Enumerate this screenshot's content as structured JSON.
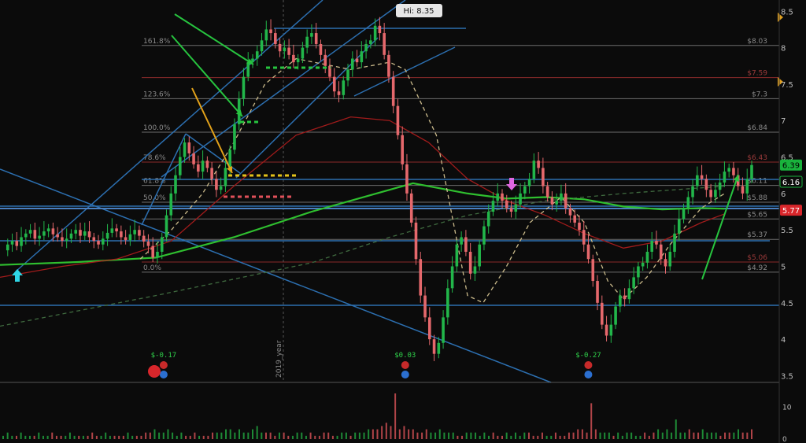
{
  "chart_data": {
    "type": "candlestick",
    "hi_label": "Hi: 8.35",
    "y_axis": {
      "range": [
        3.3,
        8.6
      ],
      "ticks": [
        "3.5",
        "4",
        "4.5",
        "5",
        "5.5",
        "6",
        "6.5",
        "7",
        "7.5",
        "8",
        "8.5"
      ]
    },
    "volume_axis": {
      "ticks": [
        "10",
        "0"
      ]
    },
    "x_annotations": {
      "divider_label": "2019_year"
    },
    "fib_levels": [
      {
        "pct": "161.8%",
        "price": "$8.03",
        "value": 8.03,
        "color": "#6d6d6d"
      },
      {
        "pct": "",
        "price": "$7.59",
        "value": 7.59,
        "color": "#8b2a2a"
      },
      {
        "pct": "123.6%",
        "price": "$7.3",
        "value": 7.3,
        "color": "#6d6d6d"
      },
      {
        "pct": "100.0%",
        "price": "$6.84",
        "value": 6.84,
        "color": "#6d6d6d"
      },
      {
        "pct": "78.6%",
        "price": "$6.43",
        "value": 6.43,
        "color": "#8b2a2a"
      },
      {
        "pct": "61.8%",
        "price": "$6.11",
        "value": 6.11,
        "color": "#6d6d6d"
      },
      {
        "pct": "50.0%",
        "price": "$5.88",
        "value": 5.88,
        "color": "#6d6d6d"
      },
      {
        "pct": "",
        "price": "$5.65",
        "value": 5.65,
        "color": "#6d6d6d"
      },
      {
        "pct": "",
        "price": "$5.37",
        "value": 5.37,
        "color": "#6d6d6d"
      },
      {
        "pct": "",
        "price": "$5.06",
        "value": 5.06,
        "color": "#8b2a2a"
      },
      {
        "pct": "0.0%",
        "price": "$4.92",
        "value": 4.92,
        "color": "#6d6d6d"
      }
    ],
    "price_badges": [
      {
        "label": "6.39",
        "value": 6.39,
        "bg": "#19b23c",
        "fg": "#000000"
      },
      {
        "label": "6.16",
        "value": 6.16,
        "bg": "#0b0b0b",
        "fg": "#ffffff",
        "border": "#19b23c"
      },
      {
        "label": "5.77",
        "value": 5.77,
        "bg": "#d8262b",
        "fg": "#ffffff"
      }
    ],
    "earnings": [
      {
        "label": "$-0.17",
        "x_frac": 0.21
      },
      {
        "label": "$0.03",
        "x_frac": 0.52
      },
      {
        "label": "$-0.27",
        "x_frac": 0.755
      }
    ],
    "series": [
      {
        "name": "Price",
        "color_up": "#22b64a",
        "color_down": "#e5686c",
        "path": [
          5.22,
          5.3,
          5.35,
          5.28,
          5.4,
          5.45,
          5.5,
          5.38,
          5.42,
          5.48,
          5.52,
          5.44,
          5.4,
          5.35,
          5.38,
          5.45,
          5.5,
          5.42,
          5.48,
          5.4,
          5.35,
          5.3,
          5.38,
          5.46,
          5.52,
          5.48,
          5.4,
          5.36,
          5.44,
          5.5,
          5.42,
          5.34,
          5.28,
          5.12,
          5.2,
          5.4,
          5.7,
          6.0,
          6.25,
          6.5,
          6.7,
          6.55,
          6.4,
          6.3,
          6.45,
          6.35,
          6.2,
          6.05,
          6.1,
          6.35,
          6.6,
          6.95,
          7.3,
          7.6,
          7.8,
          7.85,
          7.95,
          8.1,
          8.25,
          8.2,
          8.05,
          7.95,
          8.0,
          7.9,
          7.8,
          7.85,
          8.0,
          8.15,
          8.2,
          8.05,
          7.9,
          7.75,
          7.6,
          7.4,
          7.35,
          7.55,
          7.7,
          7.85,
          7.8,
          7.95,
          8.05,
          8.1,
          8.3,
          8.2,
          7.9,
          7.6,
          7.2,
          6.8,
          6.4,
          6.0,
          5.6,
          5.1,
          4.6,
          4.3,
          4.0,
          3.8,
          3.95,
          4.3,
          4.7,
          5.0,
          5.3,
          5.4,
          5.2,
          4.9,
          5.0,
          5.3,
          5.55,
          5.75,
          5.9,
          6.0,
          5.9,
          5.8,
          5.75,
          5.85,
          6.0,
          6.1,
          6.2,
          6.45,
          6.35,
          6.1,
          5.95,
          5.85,
          5.9,
          6.0,
          5.8,
          5.7,
          5.6,
          5.5,
          5.3,
          5.1,
          4.8,
          4.5,
          4.2,
          4.05,
          4.2,
          4.45,
          4.6,
          4.55,
          4.7,
          4.85,
          5.0,
          5.05,
          5.2,
          5.35,
          5.3,
          5.1,
          5.0,
          5.2,
          5.45,
          5.65,
          5.8,
          5.95,
          6.1,
          6.25,
          6.2,
          6.05,
          5.95,
          6.05,
          6.15,
          6.3,
          6.35,
          6.25,
          6.1,
          6.0,
          6.2,
          6.39
        ]
      }
    ],
    "moving_averages": [
      {
        "name": "",
        "color": "#2fbf2f",
        "style": "solid",
        "points": [
          [
            0,
            5.02
          ],
          [
            0.1,
            5.06
          ],
          [
            0.2,
            5.12
          ],
          [
            0.3,
            5.4
          ],
          [
            0.4,
            5.75
          ],
          [
            0.5,
            6.05
          ],
          [
            0.53,
            6.14
          ],
          [
            0.6,
            6.0
          ],
          [
            0.65,
            5.93
          ],
          [
            0.7,
            5.95
          ],
          [
            0.75,
            5.92
          ],
          [
            0.8,
            5.82
          ],
          [
            0.85,
            5.78
          ],
          [
            0.9,
            5.8
          ],
          [
            0.93,
            5.79
          ]
        ]
      },
      {
        "name": "",
        "color": "#a11b1b",
        "style": "solid",
        "points": [
          [
            0,
            4.85
          ],
          [
            0.08,
            5.0
          ],
          [
            0.15,
            5.1
          ],
          [
            0.22,
            5.35
          ],
          [
            0.3,
            6.1
          ],
          [
            0.38,
            6.8
          ],
          [
            0.45,
            7.05
          ],
          [
            0.5,
            7.0
          ],
          [
            0.55,
            6.7
          ],
          [
            0.6,
            6.2
          ],
          [
            0.65,
            5.9
          ],
          [
            0.7,
            5.7
          ],
          [
            0.75,
            5.45
          ],
          [
            0.8,
            5.25
          ],
          [
            0.85,
            5.35
          ],
          [
            0.9,
            5.6
          ],
          [
            0.93,
            5.72
          ]
        ]
      },
      {
        "name": "",
        "color": "#c9b98a",
        "style": "dashed",
        "points": [
          [
            0.18,
            5.1
          ],
          [
            0.22,
            5.5
          ],
          [
            0.26,
            6.0
          ],
          [
            0.3,
            6.7
          ],
          [
            0.34,
            7.5
          ],
          [
            0.38,
            7.85
          ],
          [
            0.45,
            7.7
          ],
          [
            0.5,
            7.8
          ],
          [
            0.52,
            7.7
          ],
          [
            0.56,
            6.8
          ],
          [
            0.58,
            5.7
          ],
          [
            0.6,
            4.6
          ],
          [
            0.62,
            4.5
          ],
          [
            0.65,
            5.0
          ],
          [
            0.68,
            5.6
          ],
          [
            0.72,
            5.95
          ],
          [
            0.75,
            5.6
          ],
          [
            0.78,
            4.8
          ],
          [
            0.8,
            4.55
          ],
          [
            0.83,
            4.85
          ],
          [
            0.86,
            5.3
          ],
          [
            0.9,
            5.8
          ],
          [
            0.93,
            6.0
          ]
        ]
      },
      {
        "name": "",
        "color": "#3f6a3f",
        "style": "dashed",
        "points": [
          [
            0,
            4.18
          ],
          [
            0.2,
            4.6
          ],
          [
            0.4,
            5.05
          ],
          [
            0.5,
            5.4
          ],
          [
            0.6,
            5.7
          ],
          [
            0.7,
            5.9
          ],
          [
            0.8,
            6.0
          ],
          [
            0.93,
            6.1
          ]
        ]
      }
    ],
    "volume": [
      1,
      2,
      1,
      1,
      2,
      1,
      1,
      1,
      2,
      1,
      1,
      2,
      1,
      1,
      1,
      2,
      1,
      1,
      1,
      1,
      2,
      1,
      1,
      2,
      1,
      1,
      1,
      1,
      2,
      1,
      1,
      1,
      2,
      2,
      3,
      2,
      2,
      3,
      2,
      1,
      2,
      1,
      1,
      2,
      1,
      1,
      1,
      2,
      2,
      2,
      3,
      3,
      2,
      3,
      2,
      2,
      3,
      4,
      2,
      2,
      2,
      1,
      2,
      2,
      1,
      1,
      2,
      2,
      1,
      2,
      1,
      1,
      2,
      2,
      1,
      1,
      2,
      2,
      1,
      2,
      2,
      2,
      3,
      3,
      3,
      4,
      5,
      4,
      14,
      3,
      4,
      3,
      3,
      2,
      2,
      3,
      2,
      2,
      3,
      2,
      2,
      2,
      1,
      1,
      2,
      2,
      2,
      1,
      2,
      1,
      2,
      1,
      1,
      2,
      1,
      2,
      1,
      2,
      2,
      1,
      1,
      2,
      1,
      1,
      2,
      1,
      1,
      2,
      2,
      3,
      3,
      2,
      11,
      3,
      2,
      2,
      2,
      1,
      2,
      1,
      2,
      2,
      1,
      1,
      2,
      1,
      2,
      3,
      2,
      3,
      2,
      6,
      2,
      2,
      3,
      2,
      2,
      3,
      2,
      2,
      2,
      1,
      2,
      2,
      2,
      3,
      2,
      2,
      3
    ],
    "legend_position": "none",
    "grid": false
  }
}
